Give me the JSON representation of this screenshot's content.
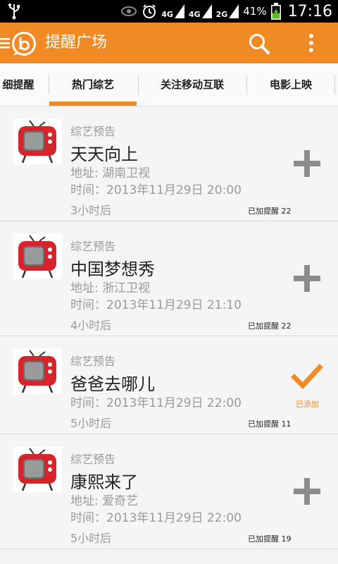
{
  "statusbar": {
    "net1": "4G",
    "net2": "4G",
    "net3": "2G",
    "battery": "41%",
    "time": "17:16"
  },
  "appbar": {
    "title": "提醒广场",
    "accent": "#f08a24"
  },
  "tabs": [
    {
      "label": "细提醒"
    },
    {
      "label": "热门综艺",
      "selected": true
    },
    {
      "label": "关注移动互联"
    },
    {
      "label": "电影上映"
    }
  ],
  "items": [
    {
      "category": "综艺预告",
      "name": "天天向上",
      "address": "地址: 湖南卫视",
      "time": "时间：2013年11月29日 20:00",
      "relative": "3小时后",
      "reminders": "已加提醒 22",
      "state": "add"
    },
    {
      "category": "综艺预告",
      "name": "中国梦想秀",
      "address": "地址: 浙江卫视",
      "time": "时间：2013年11月29日 21:10",
      "relative": "4小时后",
      "reminders": "已加提醒 22",
      "state": "add"
    },
    {
      "category": "综艺预告",
      "name": "爸爸去哪儿",
      "time": "时间：2013年11月29日 22:00",
      "relative": "5小时后",
      "reminders": "已加提醒 11",
      "state": "added",
      "added_label": "已添加"
    },
    {
      "category": "综艺预告",
      "name": "康熙来了",
      "address": "地址: 爱奇艺",
      "time": "时间：2013年11月29日 22:00",
      "relative": "5小时后",
      "reminders": "已加提醒 19",
      "state": "add"
    }
  ]
}
